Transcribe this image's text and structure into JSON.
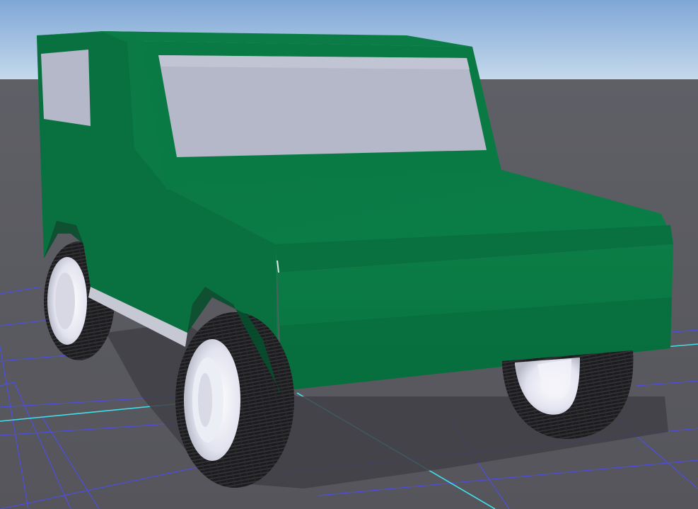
{
  "scene": {
    "sky_top_color": "#7fa7d6",
    "sky_horizon_color": "#c9dced",
    "ground_color": "#5c5c62",
    "grid_color": "#4a4adf",
    "x_axis_color": "#3fe0e6",
    "body_color": "#0b7a45",
    "body_shadow_color": "#075f34",
    "body_dark_color": "#064d2a",
    "glass_color": "#b5b8c8",
    "tire_color": "#1c1c1e",
    "rim_color": "#e7e8f3",
    "trim_color": "#c5c7d2"
  }
}
